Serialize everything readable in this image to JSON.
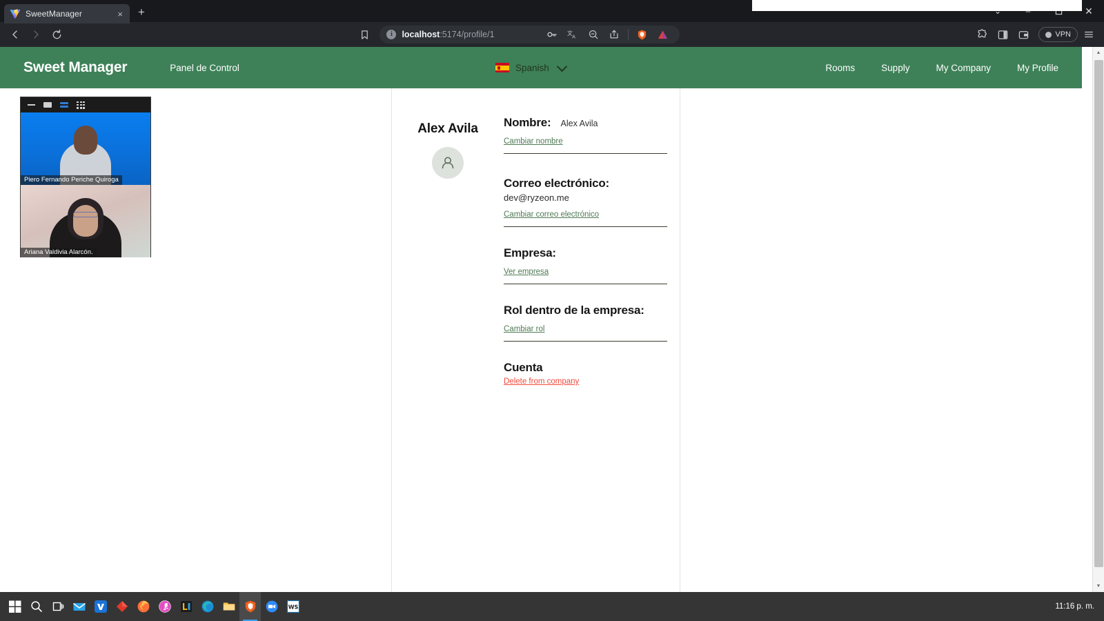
{
  "browser": {
    "tab": {
      "title": "SweetManager",
      "favicon": "vite-logo-icon",
      "close": "×"
    },
    "new_tab": "+",
    "window_controls": {
      "minimize": "–",
      "maximize": "❐",
      "close": "✕",
      "chevron": "⌄"
    },
    "nav_back": "‹",
    "nav_forward": "›",
    "reload": "⟳",
    "bookmark_icon": "bookmark-icon",
    "url": {
      "host": "localhost",
      "path": ":5174/profile/1",
      "full": "localhost:5174/profile/1"
    },
    "omnibox_icons": [
      "password-key-icon",
      "translate-icon",
      "zoom-out-icon",
      "share-icon",
      "brave-shields-icon",
      "brave-rewards-icon"
    ],
    "toolbar_right_icons": [
      "extensions-puzzle-icon",
      "sidebar-panel-icon",
      "brave-wallet-icon"
    ],
    "vpn_label": "VPN"
  },
  "app": {
    "brand": "Sweet Manager",
    "panel_label": "Panel de Control",
    "language": {
      "name": "Spanish",
      "flag": "spain-flag-icon",
      "chevron": "chevron-down-icon"
    },
    "nav": [
      {
        "label": "Rooms"
      },
      {
        "label": "Supply"
      },
      {
        "label": "My Company"
      },
      {
        "label": "My Profile"
      }
    ],
    "accent_green": "#3e8158",
    "link_green": "#4f7a55",
    "danger_red": "#f0493c"
  },
  "profile": {
    "display_name": "Alex Avila",
    "avatar_icon": "person-avatar-icon",
    "fields": [
      {
        "title": "Nombre:",
        "inline_value": "Alex Avila",
        "value": "",
        "link": "Cambiar nombre"
      },
      {
        "title": "Correo electrónico:",
        "inline_value": "",
        "value": "dev@ryzeon.me",
        "link": "Cambiar correo electrónico"
      },
      {
        "title": "Empresa:",
        "inline_value": "",
        "value": "",
        "link": "Ver empresa"
      },
      {
        "title": "Rol dentro de la empresa:",
        "inline_value": "",
        "value": "",
        "link": "Cambiar rol"
      }
    ],
    "account": {
      "title": "Cuenta",
      "delete_link": "Delete from company"
    }
  },
  "call_overlay": {
    "controls": [
      "minimize-icon",
      "maximize-icon",
      "split-view-icon",
      "grid-view-icon"
    ],
    "participants": [
      {
        "name": "Piero Fernando Periche Quiroga"
      },
      {
        "name": "Ariana Valdivia Alarcón."
      }
    ]
  },
  "scrollbar": {
    "up_arrow": "▲",
    "down_arrow": "▼"
  },
  "taskbar": {
    "items": [
      {
        "name": "start-button"
      },
      {
        "name": "search-icon"
      },
      {
        "name": "task-view-icon"
      },
      {
        "name": "mail-icon"
      },
      {
        "name": "vivaldi-icon"
      },
      {
        "name": "ruby-icon"
      },
      {
        "name": "firefox-icon"
      },
      {
        "name": "itunes-icon"
      },
      {
        "name": "lumion-icon"
      },
      {
        "name": "edge-icon"
      },
      {
        "name": "file-explorer-icon"
      },
      {
        "name": "brave-icon"
      },
      {
        "name": "zoom-icon"
      },
      {
        "name": "vscode-icon"
      }
    ],
    "clock": "11:16 p. m."
  }
}
